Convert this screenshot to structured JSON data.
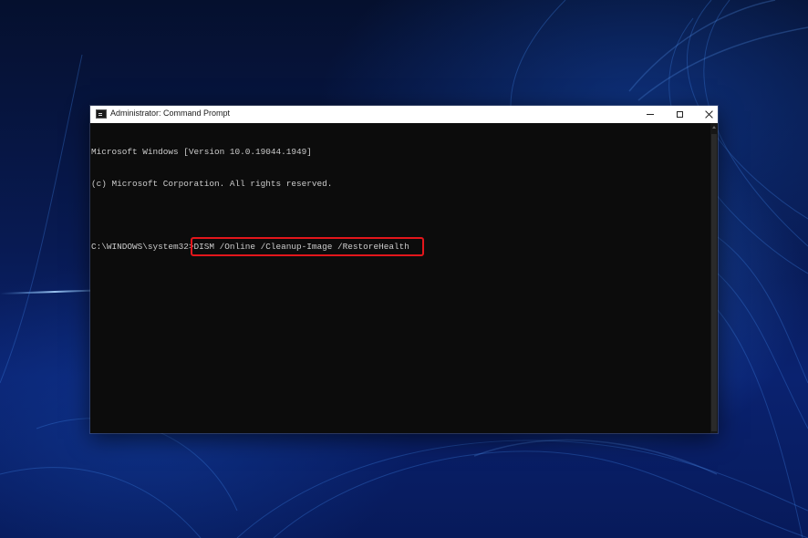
{
  "window": {
    "title": "Administrator: Command Prompt",
    "controls": {
      "minimize_icon": "minimize-icon",
      "maximize_icon": "maximize-icon",
      "close_icon": "close-icon"
    }
  },
  "console": {
    "lines": [
      "Microsoft Windows [Version 10.0.19044.1949]",
      "(c) Microsoft Corporation. All rights reserved."
    ],
    "prompt": "C:\\WINDOWS\\system32>",
    "command": "DISM /Online /Cleanup-Image /RestoreHealth",
    "background_color": "#0c0c0c",
    "text_color": "#cccccc",
    "highlight_color": "#e3161b"
  }
}
